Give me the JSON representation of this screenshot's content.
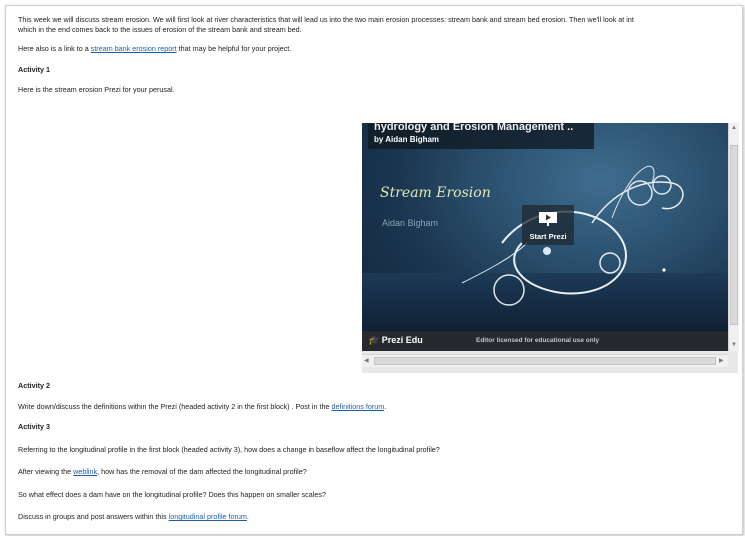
{
  "intro": {
    "line1": "This week we will discuss stream erosion. We will first look at river characteristics that will lead us into the two main erosion processes: stream bank and stream bed erosion. Then we'll look at int",
    "line2": "which in the end comes back to the issues of erosion of the stream bank and stream bed."
  },
  "report": {
    "before": "Here also is a link to a ",
    "link": "stream bank erosion report",
    "after": " that may be helpful for your project."
  },
  "activity1": {
    "heading": "Activity 1",
    "text": "Here is the stream erosion Prezi for your perusal."
  },
  "prezi": {
    "title": "hydrology and Erosion Management ..",
    "author_line": "by Aidan Bigham",
    "slide_title": "Stream Erosion",
    "slide_author": "Aidan Bigham",
    "start_label": "Start Prezi",
    "brand": "Prezi Edu",
    "license": "Editor licensed for educational use only"
  },
  "activity2": {
    "heading": "Activity 2",
    "before": "Write down/discuss the definitions within the Prezi (headed activity 2 in the first block) . Post in the ",
    "link": "definitions forum",
    "after": "."
  },
  "activity3": {
    "heading": "Activity 3",
    "q1": "Referring to the longitudinal profile in the first block (headed activity 3), how does a change in baseflow affect the longitudinal profile?",
    "q2_before": "After viewing the ",
    "q2_link": "weblink",
    "q2_after": ", how has the removal of the dam affected the longitudinal profile?",
    "q3": "So what effect does a dam have on the longitudinal profile? Does this happen on smaller scales?",
    "q4_before": "Discuss in groups and post answers within this ",
    "q4_link": "longitudinal profile forum",
    "q4_after": "."
  },
  "colors": {
    "link": "#1f5fa8",
    "prezi_bar": "#262a2e"
  }
}
